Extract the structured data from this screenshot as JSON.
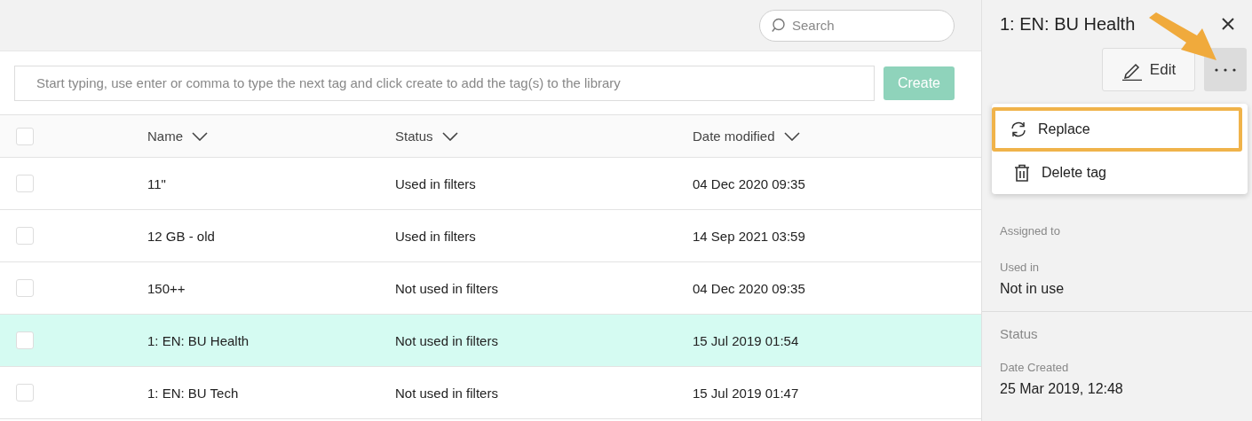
{
  "search": {
    "placeholder": "Search"
  },
  "tag_input": {
    "placeholder": "Start typing, use enter or comma to type the next tag and click create to add the tag(s) to the library"
  },
  "create_button": {
    "label": "Create",
    "disabled": true
  },
  "table": {
    "select_all": {
      "checked": false
    },
    "columns": [
      "Name",
      "Status",
      "Date modified"
    ],
    "rows": [
      {
        "name": "11\"",
        "status": "Used in filters",
        "date": "04 Dec 2020 09:35",
        "selected": false,
        "checked": false
      },
      {
        "name": "12 GB - old",
        "status": "Used in filters",
        "date": "14 Sep 2021 03:59",
        "selected": false,
        "checked": false
      },
      {
        "name": "150++",
        "status": "Not used in filters",
        "date": "04 Dec 2020 09:35",
        "selected": false,
        "checked": false
      },
      {
        "name": "1: EN: BU Health",
        "status": "Not used in filters",
        "date": "15 Jul 2019 01:54",
        "selected": true,
        "checked": false
      },
      {
        "name": "1: EN: BU Tech",
        "status": "Not used in filters",
        "date": "15 Jul 2019 01:47",
        "selected": false,
        "checked": false
      }
    ]
  },
  "panel": {
    "title": "1: EN: BU Health",
    "edit_button": "Edit",
    "menu": [
      {
        "label": "Replace",
        "kind": "replace",
        "highlighted": true
      },
      {
        "label": "Delete tag",
        "kind": "delete",
        "highlighted": false
      }
    ],
    "fields": [
      {
        "label": "Assigned to"
      },
      {
        "label": "Used in",
        "value": "Not in use"
      }
    ],
    "section": "Status",
    "status_fields": [
      {
        "label": "Date Created",
        "value": "25 Mar 2019, 12:48"
      }
    ]
  }
}
